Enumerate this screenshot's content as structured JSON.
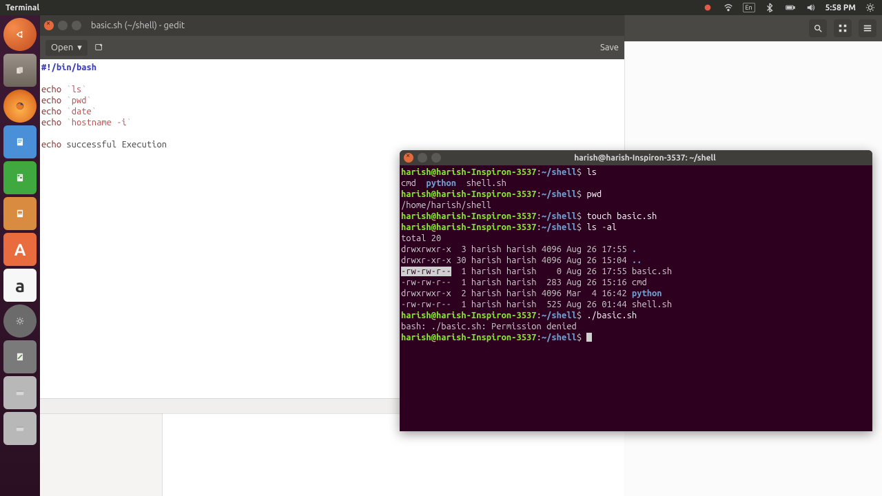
{
  "menubar": {
    "app_title": "Terminal",
    "time": "5:58 PM",
    "lang_indicator": "En"
  },
  "launcher": {
    "items": [
      "ubuntu-dash",
      "files",
      "firefox",
      "writer",
      "calc",
      "impress",
      "software",
      "terminal",
      "amazon",
      "settings",
      "text-editor",
      "disk",
      "disk2"
    ]
  },
  "nautilus": {
    "search_label": "Search",
    "view_label": "List view",
    "menu_label": "Menu"
  },
  "gedit": {
    "title": "basic.sh (~/shell) - gedit",
    "open_label": "Open",
    "save_label": "Save",
    "lang": "sh",
    "code": {
      "shebang": "#!/bin/bash",
      "l3_echo": "echo",
      "l3_cmd": "ls",
      "l4_echo": "echo",
      "l4_cmd": "pwd",
      "l5_echo": "echo",
      "l5_cmd": "date",
      "l6_echo": "echo",
      "l6_cmd": "hostname",
      "l6_flag": "-i",
      "l8_echo": "echo",
      "l8_text": "successful Execution"
    }
  },
  "terminal": {
    "title": "harish@harish-Inspiron-3537: ~/shell",
    "prompt_user_host": "harish@harish-Inspiron-3537",
    "prompt_sep": ":",
    "prompt_path": "~/shell",
    "prompt_sym": "$",
    "lines": {
      "c1": "ls",
      "r1a": "cmd  ",
      "r1b": "python",
      "r1c": "  shell.sh",
      "c2": "pwd",
      "r2": "/home/harish/shell",
      "c3": "touch basic.sh",
      "c4": "ls -al",
      "r4_total": "total 20",
      "r4_1a": "drwxrwxr-x  3 harish harish 4096 Aug 26 17:55 ",
      "r4_1b": ".",
      "r4_2a": "drwxr-xr-x 30 harish harish 4096 Aug 26 15:04 ",
      "r4_2b": "..",
      "r4_3a": "-rw-rw-r--",
      "r4_3b": "  1 harish harish    0 Aug 26 17:55 basic.sh",
      "r4_4": "-rw-rw-r--  1 harish harish  283 Aug 26 15:16 cmd",
      "r4_5a": "drwxrwxr-x  2 harish harish 4096 Mar  4 16:42 ",
      "r4_5b": "python",
      "r4_6": "-rw-rw-r--  1 harish harish  525 Aug 26 01:44 shell.sh",
      "c5": "./basic.sh",
      "r5": "bash: ./basic.sh: Permission denied"
    }
  }
}
